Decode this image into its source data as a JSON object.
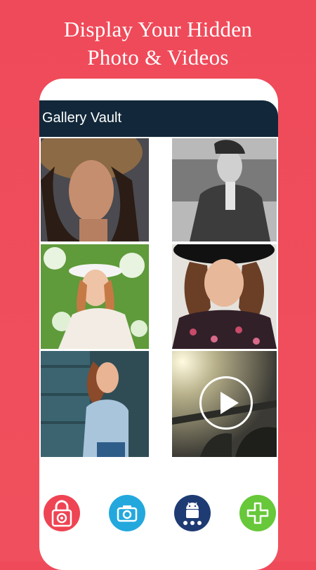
{
  "promo": {
    "line1": "Display Your Hidden",
    "line2": "Photo & Videos"
  },
  "app": {
    "title": "Gallery Vault"
  },
  "gallery": {
    "items": [
      {
        "type": "photo"
      },
      {
        "type": "photo"
      },
      {
        "type": "photo"
      },
      {
        "type": "photo"
      },
      {
        "type": "photo"
      },
      {
        "type": "video"
      }
    ]
  },
  "bottom_bar": [
    {
      "icon": "lock-gear-icon",
      "color": "#ef4453"
    },
    {
      "icon": "camera-icon",
      "color": "#23a8de"
    },
    {
      "icon": "android-icon",
      "color": "#1e3b73"
    },
    {
      "icon": "plus-icon",
      "color": "#67c839"
    }
  ],
  "colors": {
    "background": "#ef4a5a",
    "app_bar": "#12283a"
  }
}
